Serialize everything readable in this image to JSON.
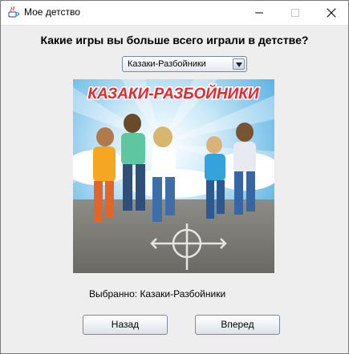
{
  "window": {
    "title": "Мое детство"
  },
  "main": {
    "question": "Какие игры вы больше всего играли в детстве?",
    "combo": {
      "selected": "Казаки-Разбойники"
    },
    "picture": {
      "banner_text": "КАЗАКИ-РАЗБОЙНИКИ"
    },
    "selected_label": "Выбранно: Казаки-Разбойники",
    "buttons": {
      "back": "Назад",
      "next": "Вперед"
    }
  },
  "colors": {
    "window_bg": "#eeeeee",
    "banner_red": "#e8262b",
    "sky_blue": "#5fb7e6"
  }
}
